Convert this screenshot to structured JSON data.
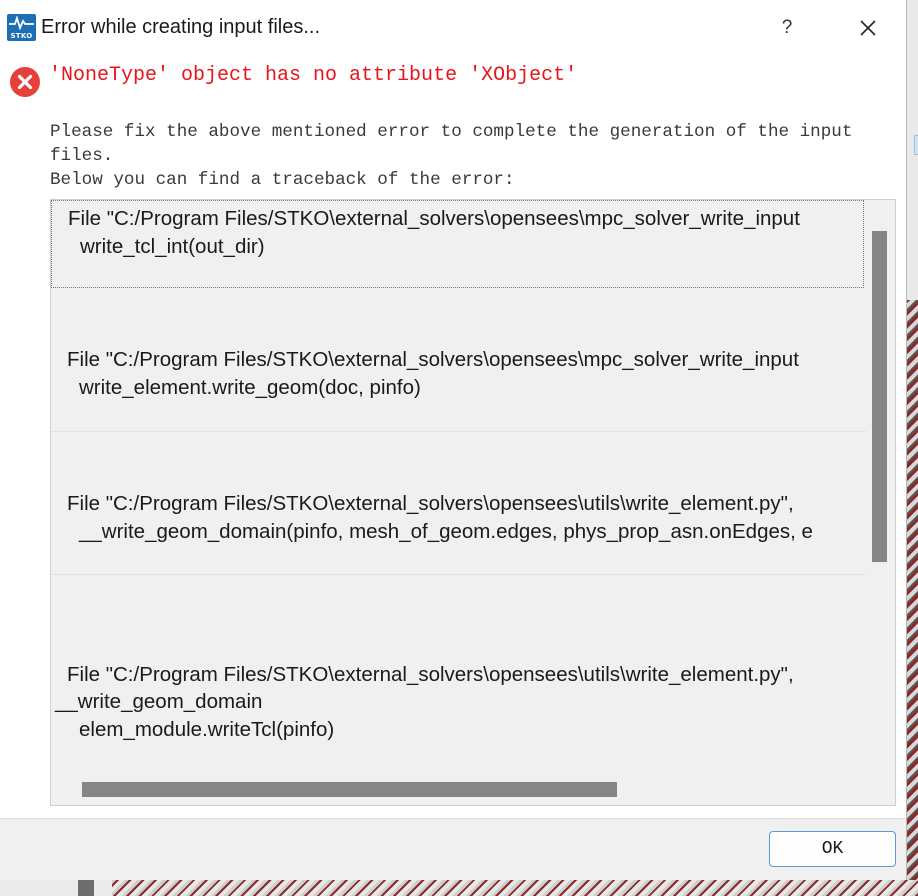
{
  "window": {
    "title": "Error while creating input files...",
    "logo_text": "STKO",
    "help_label": "?",
    "logo_color": "#1c6fb5"
  },
  "error": {
    "icon": "error-x-icon",
    "message": "'NoneType' object has no attribute 'XObject'",
    "color": "#e8141b"
  },
  "info": {
    "line1": "Please fix the above mentioned error to complete the generation of the input",
    "line2": "files.",
    "line3": "Below you can find a traceback of the error:"
  },
  "traceback": [
    {
      "file": "File \"C:/Program Files/STKO\\external_solvers\\opensees\\mpc_solver_write_input",
      "code": "write_tcl_int(out_dir)"
    },
    {
      "file": "File \"C:/Program Files/STKO\\external_solvers\\opensees\\mpc_solver_write_input",
      "code": "write_element.write_geom(doc, pinfo)"
    },
    {
      "file": "File \"C:/Program Files/STKO\\external_solvers\\opensees\\utils\\write_element.py\",",
      "code": "__write_geom_domain(pinfo, mesh_of_geom.edges,  phys_prop_asn.onEdges, e"
    },
    {
      "file": "File \"C:/Program Files/STKO\\external_solvers\\opensees\\utils\\write_element.py\",",
      "func": "__write_geom_domain",
      "code": "elem_module.writeTcl(pinfo)"
    }
  ],
  "buttons": {
    "ok": "OK"
  }
}
